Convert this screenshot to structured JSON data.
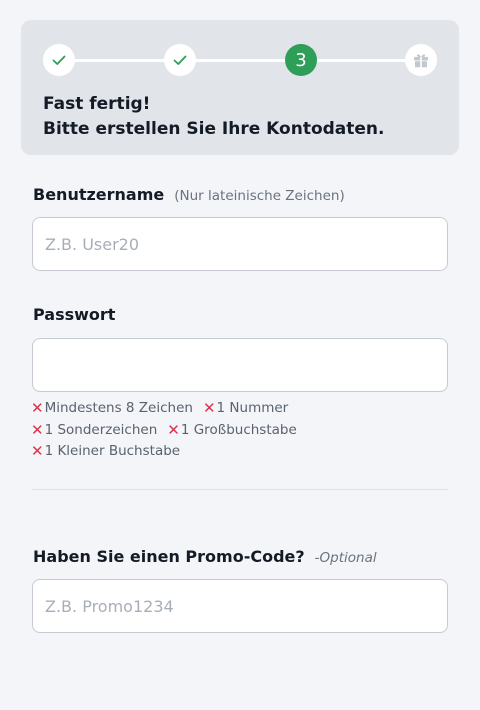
{
  "stepper": {
    "steps": [
      {
        "state": "done",
        "icon": "check-icon"
      },
      {
        "state": "done",
        "icon": "check-icon"
      },
      {
        "state": "current",
        "number": "3"
      },
      {
        "state": "todo",
        "icon": "gift-icon"
      }
    ],
    "title_line1": "Fast fertig!",
    "title_line2": "Bitte erstellen Sie Ihre Kontodaten.",
    "colors": {
      "done_check": "#2e9e58",
      "current_bg": "#2e9e58",
      "todo_icon": "#c3c8d0"
    }
  },
  "username": {
    "label": "Benutzername",
    "hint": "(Nur lateinische Zeichen)",
    "placeholder": "Z.B. User20",
    "value": ""
  },
  "password": {
    "label": "Passwort",
    "value": "",
    "rules": [
      "Mindestens 8 Zeichen",
      "1 Nummer",
      "1 Sonderzeichen",
      "1 Großbuchstabe",
      "1 Kleiner Buchstabe"
    ],
    "rule_mark": "✕"
  },
  "promo": {
    "label": "Haben Sie einen Promo-Code?",
    "hint": "-Optional",
    "placeholder": "Z.B. Promo1234",
    "value": ""
  }
}
